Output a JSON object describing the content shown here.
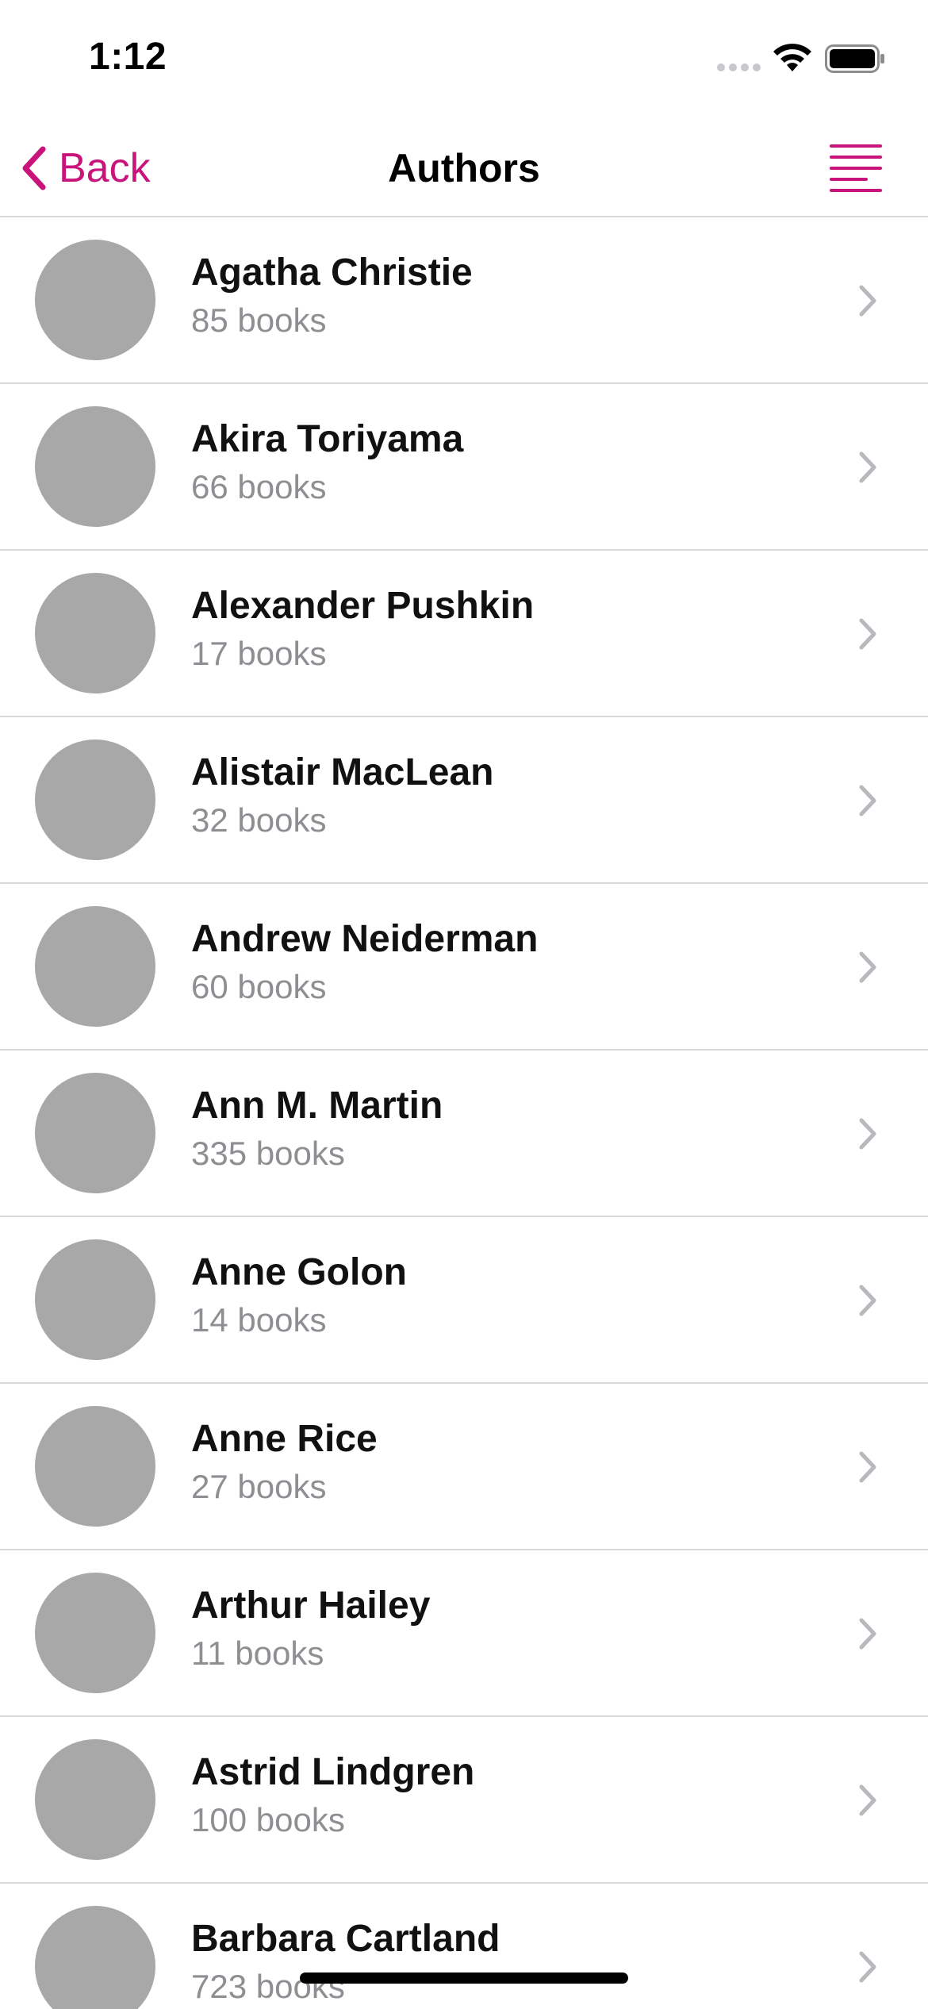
{
  "status_bar": {
    "time": "1:12",
    "signal_icon": "cellular-signal-icon",
    "wifi_icon": "wifi-icon",
    "battery_icon": "battery-full-icon"
  },
  "nav": {
    "back_label": "Back",
    "back_icon": "chevron-left-icon",
    "title": "Authors",
    "menu_icon": "sort-lines-icon",
    "accent_color": "#c8147b"
  },
  "authors": [
    {
      "name": "Agatha Christie",
      "count": "85 books"
    },
    {
      "name": "Akira Toriyama",
      "count": "66 books"
    },
    {
      "name": "Alexander Pushkin",
      "count": "17 books"
    },
    {
      "name": "Alistair MacLean",
      "count": "32 books"
    },
    {
      "name": "Andrew Neiderman",
      "count": "60 books"
    },
    {
      "name": "Ann M. Martin",
      "count": "335 books"
    },
    {
      "name": "Anne Golon",
      "count": "14 books"
    },
    {
      "name": "Anne Rice",
      "count": "27 books"
    },
    {
      "name": "Arthur Hailey",
      "count": "11 books"
    },
    {
      "name": "Astrid Lindgren",
      "count": "100 books"
    },
    {
      "name": "Barbara Cartland",
      "count": "723 books"
    }
  ],
  "colors": {
    "avatar_placeholder": "#a8a8a8",
    "secondary_text": "#8e8e93",
    "separator": "#d8d8dc"
  }
}
